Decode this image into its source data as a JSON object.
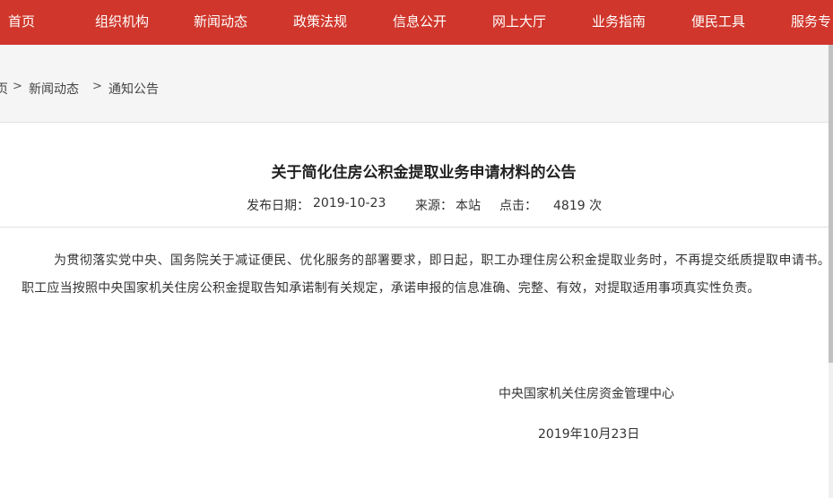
{
  "nav": {
    "items": [
      {
        "label": "首页"
      },
      {
        "label": "组织机构"
      },
      {
        "label": "新闻动态"
      },
      {
        "label": "政策法规"
      },
      {
        "label": "信息公开"
      },
      {
        "label": "网上大厅"
      },
      {
        "label": "业务指南"
      },
      {
        "label": "便民工具"
      },
      {
        "label": "服务专"
      }
    ],
    "background": "#d0362b"
  },
  "breadcrumb": {
    "items": [
      "页",
      "新闻动态",
      "通知公告"
    ],
    "separator": ">"
  },
  "article": {
    "title": "关于简化住房公积金提取业务申请材料的公告",
    "publish_label": "发布日期：",
    "publish_date": "2019-10-23",
    "source_label": "来源：",
    "source": "本站",
    "views_label": "点击：",
    "views": "4819 次",
    "body": "为贯彻落实党中央、国务院关于减证便民、优化服务的部署要求，即日起，职工办理住房公积金提取业务时，不再提交纸质提取申请书。职工应当按照中央国家机关住房公积金提取告知承诺制有关规定，承诺申报的信息准确、完整、有效，对提取适用事项真实性负责。",
    "signer": "中央国家机关住房资金管理中心",
    "sign_date": "2019年10月23日"
  }
}
